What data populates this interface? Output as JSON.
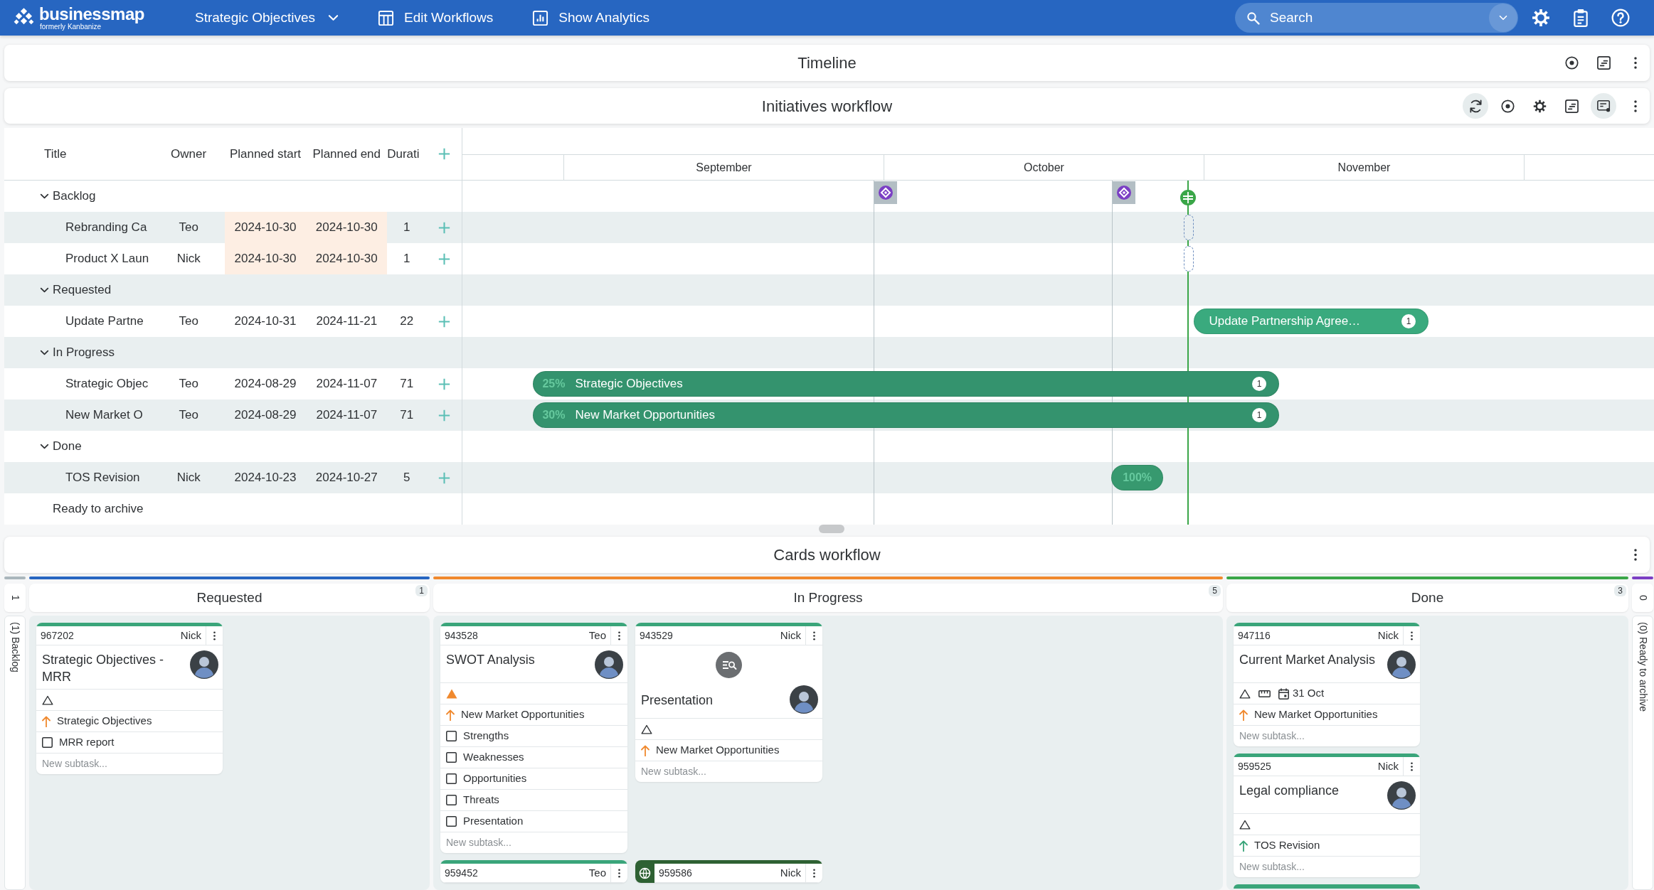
{
  "topbar": {
    "logo": {
      "name": "businessmap",
      "tagline": "formerly Kanbanize"
    },
    "nav": [
      {
        "label": "Strategic Objectives",
        "kind": "dropdown"
      },
      {
        "label": "Edit Workflows",
        "kind": "workflows"
      },
      {
        "label": "Show Analytics",
        "kind": "analytics"
      }
    ],
    "search": {
      "placeholder": "Search"
    },
    "tools": [
      {
        "kind": "settings"
      },
      {
        "kind": "clipboard"
      },
      {
        "kind": "help"
      }
    ]
  },
  "timeline": {
    "title": "Timeline",
    "tools": [
      {
        "kind": "target"
      },
      {
        "kind": "note"
      },
      {
        "kind": "more"
      }
    ]
  },
  "initiatives": {
    "title": "Initiatives workflow",
    "tools": [
      {
        "kind": "refresh",
        "selected": true
      },
      {
        "kind": "target",
        "selected": false
      },
      {
        "kind": "settings",
        "selected": false
      },
      {
        "kind": "note",
        "selected": false
      },
      {
        "kind": "flow",
        "selected": true
      },
      {
        "kind": "more",
        "selected": false
      }
    ]
  },
  "table": {
    "columns": [
      "Title",
      "Owner",
      "Planned start",
      "Planned end",
      "Durati"
    ],
    "months": [
      "September",
      "October",
      "November"
    ],
    "groups": [
      {
        "label": "Backlog",
        "expanded": true,
        "children": [
          {
            "title": "Rebranding Ca",
            "owner": "Teo",
            "planned_start": "2024-10-30",
            "planned_end": "2024-10-30",
            "duration": "1",
            "dates_highlighted": true,
            "bar": {
              "kind": "dashed"
            }
          },
          {
            "title": "Product X Laun",
            "owner": "Nick",
            "planned_start": "2024-10-30",
            "planned_end": "2024-10-30",
            "duration": "1",
            "dates_highlighted": true,
            "bar": {
              "kind": "dashed"
            }
          }
        ]
      },
      {
        "label": "Requested",
        "expanded": true,
        "children": [
          {
            "title": "Update Partne",
            "owner": "Teo",
            "planned_start": "2024-10-31",
            "planned_end": "2024-11-21",
            "duration": "22",
            "dates_highlighted": false,
            "bar": {
              "kind": "solid",
              "label": "Update Partnership Agree…",
              "badge": "1",
              "color": "#3aaa7e"
            }
          }
        ]
      },
      {
        "label": "In Progress",
        "expanded": true,
        "children": [
          {
            "title": "Strategic Objec",
            "owner": "Teo",
            "planned_start": "2024-08-29",
            "planned_end": "2024-11-07",
            "duration": "71",
            "dates_highlighted": false,
            "bar": {
              "kind": "solid",
              "progress": "25%",
              "label": "Strategic Objectives",
              "badge": "1",
              "color": "#34936e"
            }
          },
          {
            "title": "New Market O",
            "owner": "Teo",
            "planned_start": "2024-08-29",
            "planned_end": "2024-11-07",
            "duration": "71",
            "dates_highlighted": false,
            "bar": {
              "kind": "solid",
              "progress": "30%",
              "label": "New Market Opportunities",
              "badge": "1",
              "color": "#34936e"
            }
          }
        ]
      },
      {
        "label": "Done",
        "expanded": true,
        "children": [
          {
            "title": "TOS Revision",
            "owner": "Nick",
            "planned_start": "2024-10-23",
            "planned_end": "2024-10-27",
            "duration": "5",
            "dates_highlighted": false,
            "bar": {
              "kind": "solid",
              "progress": "100%",
              "color": "#37996f"
            }
          }
        ]
      },
      {
        "label": "Ready to archive"
      }
    ]
  },
  "cards_workflow": {
    "title": "Cards workflow",
    "tools": [
      {
        "kind": "more"
      }
    ],
    "columns": [
      {
        "kind": "collapsed",
        "label": "(1) Backlog",
        "count": "1",
        "color": "#aab6bc"
      },
      {
        "kind": "open",
        "label": "Requested",
        "count": "1",
        "color": "#2766c1",
        "cards": [
          {
            "id": "967202",
            "owner": "Nick",
            "title": "Strategic Objectives - MRR",
            "color": "#3aa57a",
            "avatar": true,
            "triangle_filled": false,
            "links": [
              {
                "label": "Strategic Objectives",
                "color": "#f0892e"
              }
            ],
            "subtasks": [
              {
                "label": "MRR report",
                "checked": false
              }
            ],
            "new_subtask": {
              "placeholder": "New subtask..."
            }
          }
        ]
      },
      {
        "kind": "open",
        "label": "In Progress",
        "count": "5",
        "color": "#f0892e",
        "cards": [
          {
            "id": "943528",
            "owner": "Teo",
            "title": "SWOT Analysis",
            "color": "#3aa57a",
            "avatar": true,
            "triangle_filled": true,
            "links": [
              {
                "label": "New Market Opportunities",
                "color": "#f0892e"
              }
            ],
            "subtasks": [
              {
                "label": "Strengths",
                "checked": false
              },
              {
                "label": "Weaknesses",
                "checked": false
              },
              {
                "label": "Opportunities",
                "checked": false
              },
              {
                "label": "Threats",
                "checked": false
              },
              {
                "label": "Presentation",
                "checked": false
              }
            ],
            "new_subtask": {
              "placeholder": "New subtask..."
            }
          },
          {
            "id": "943529",
            "owner": "Nick",
            "research_icon": true,
            "title": "Presentation",
            "color": "#3aa57a",
            "avatar": true,
            "triangle_filled": false,
            "links": [
              {
                "label": "New Market Opportunities",
                "color": "#f0892e"
              }
            ],
            "new_subtask": {
              "placeholder": "New subtask..."
            }
          },
          {
            "id": "959452",
            "owner": "Teo",
            "color": "#3aa57a"
          },
          {
            "id": "959586",
            "owner": "Nick",
            "globe_icon": true,
            "color": "#2e6133"
          }
        ]
      },
      {
        "kind": "open",
        "label": "Done",
        "count": "3",
        "color": "#3aa648",
        "cards": [
          {
            "id": "947116",
            "owner": "Nick",
            "title": "Current Market Analysis",
            "color": "#3aa57a",
            "avatar": true,
            "triangle_filled": false,
            "size_icon": true,
            "deadline": "31 Oct",
            "links": [
              {
                "label": "New Market Opportunities",
                "color": "#f0892e"
              }
            ],
            "new_subtask": {
              "placeholder": "New subtask..."
            }
          },
          {
            "id": "959525",
            "owner": "Nick",
            "title": "Legal compliance",
            "color": "#3aa57a",
            "avatar": true,
            "triangle_filled": false,
            "links": [
              {
                "label": "TOS Revision",
                "color": "#3aa57a"
              }
            ],
            "new_subtask": {
              "placeholder": "New subtask..."
            }
          },
          {
            "color": "#3aa57a"
          }
        ]
      },
      {
        "kind": "collapsed",
        "label": "(0) Ready to archive",
        "count": "0",
        "color": "#7b3fc4"
      }
    ]
  }
}
